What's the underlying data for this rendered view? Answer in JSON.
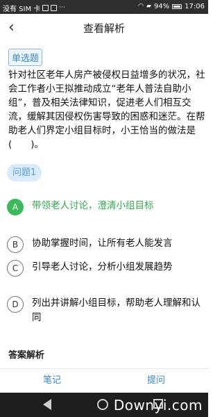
{
  "status_bar": {
    "carrier": "没有 SIM 卡",
    "battery": "94%",
    "time": "17:06"
  },
  "header": {
    "title": "查看解析",
    "back_icon": "chevron-left-icon"
  },
  "question": {
    "type_tag": "单选题",
    "text": "针对社区老年人房产被侵权日益增多的状况，社会工作者小王拟推动成立“老年人普法自助小组”，普及相关法律知识，促进老人们相互交流，缓解其因侵权伤害导致的困惑和迷茫。在帮助老人们界定小组目标时，小王恰当的做法是(　　)。",
    "chip_label": "问题1"
  },
  "options": [
    {
      "letter": "A",
      "text": "带领老人讨论，澄清小组目标",
      "correct": true
    },
    {
      "letter": "B",
      "text": "协助掌握时间，让所有老人能发言",
      "correct": false
    },
    {
      "letter": "C",
      "text": "引导老人讨论，分析小组发展趋势",
      "correct": false
    },
    {
      "letter": "D",
      "text": "列出并讲解小组目标，帮助老人理解和认同",
      "correct": false
    }
  ],
  "analysis": {
    "title": "答案解析"
  },
  "bottom_bar": {
    "notes_label": "笔记",
    "ask_label": "提问"
  },
  "watermark": "Downyi.com",
  "colors": {
    "accent": "#3a87c8",
    "correct": "#3cb95a",
    "chip_bg": "#d9ebf8"
  }
}
